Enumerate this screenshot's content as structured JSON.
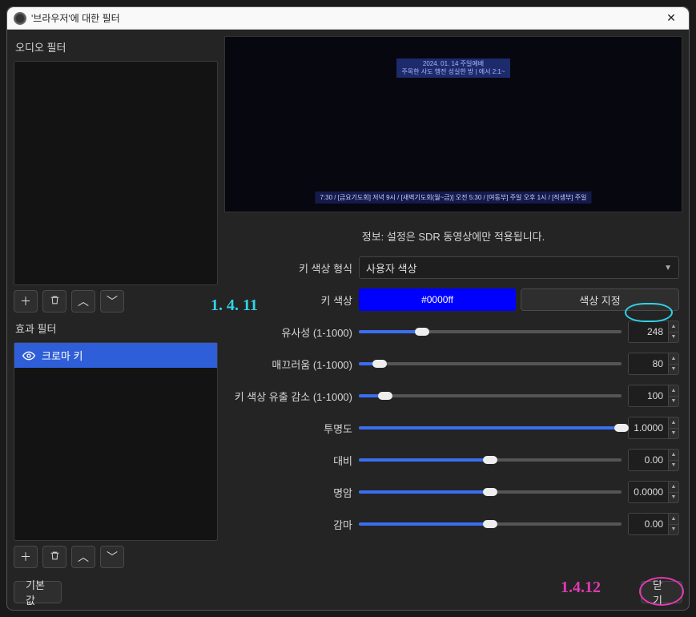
{
  "window": {
    "title": "'브라우저'에 대한 필터"
  },
  "left": {
    "audio_label": "오디오 필터",
    "effect_label": "효과 필터",
    "filters": [
      {
        "name": "크로마 키",
        "selected": true
      }
    ],
    "tools": {
      "add": "+",
      "remove": "🗑",
      "up": "⌃",
      "down": "⌄"
    }
  },
  "preview": {
    "banner_line1": "2024. 01. 14 주일예배",
    "banner_line2": "주목한 사도 행전 성실한 방 | 에서 2:1~",
    "ticker": "7:30 / [금요기도회] 저녁 9시 / [새벽기도회(월~금)] 오전 5:30 / [여동부] 주일 오후 1시 / [직생부] 주일"
  },
  "info": "정보: 설정은 SDR 동영상에만 적용됩니다.",
  "form": {
    "key_color_type": {
      "label": "키 색상 형식",
      "value": "사용자 색상"
    },
    "key_color": {
      "label": "키 색상",
      "hex": "#0000ff",
      "pick": "색상 지정"
    },
    "sliders": [
      {
        "label": "유사성 (1-1000)",
        "value": "248",
        "pct": 24
      },
      {
        "label": "매끄러움 (1-1000)",
        "value": "80",
        "pct": 8
      },
      {
        "label": "키 색상 유출 감소 (1-1000)",
        "value": "100",
        "pct": 10
      },
      {
        "label": "투명도",
        "value": "1.0000",
        "pct": 100
      },
      {
        "label": "대비",
        "value": "0.00",
        "pct": 50
      },
      {
        "label": "명암",
        "value": "0.0000",
        "pct": 50
      },
      {
        "label": "감마",
        "value": "0.00",
        "pct": 50
      }
    ]
  },
  "footer": {
    "defaults": "기본값",
    "close": "닫기"
  },
  "annotations": {
    "cyan": "1. 4. 11",
    "pink": "1.4.12"
  }
}
